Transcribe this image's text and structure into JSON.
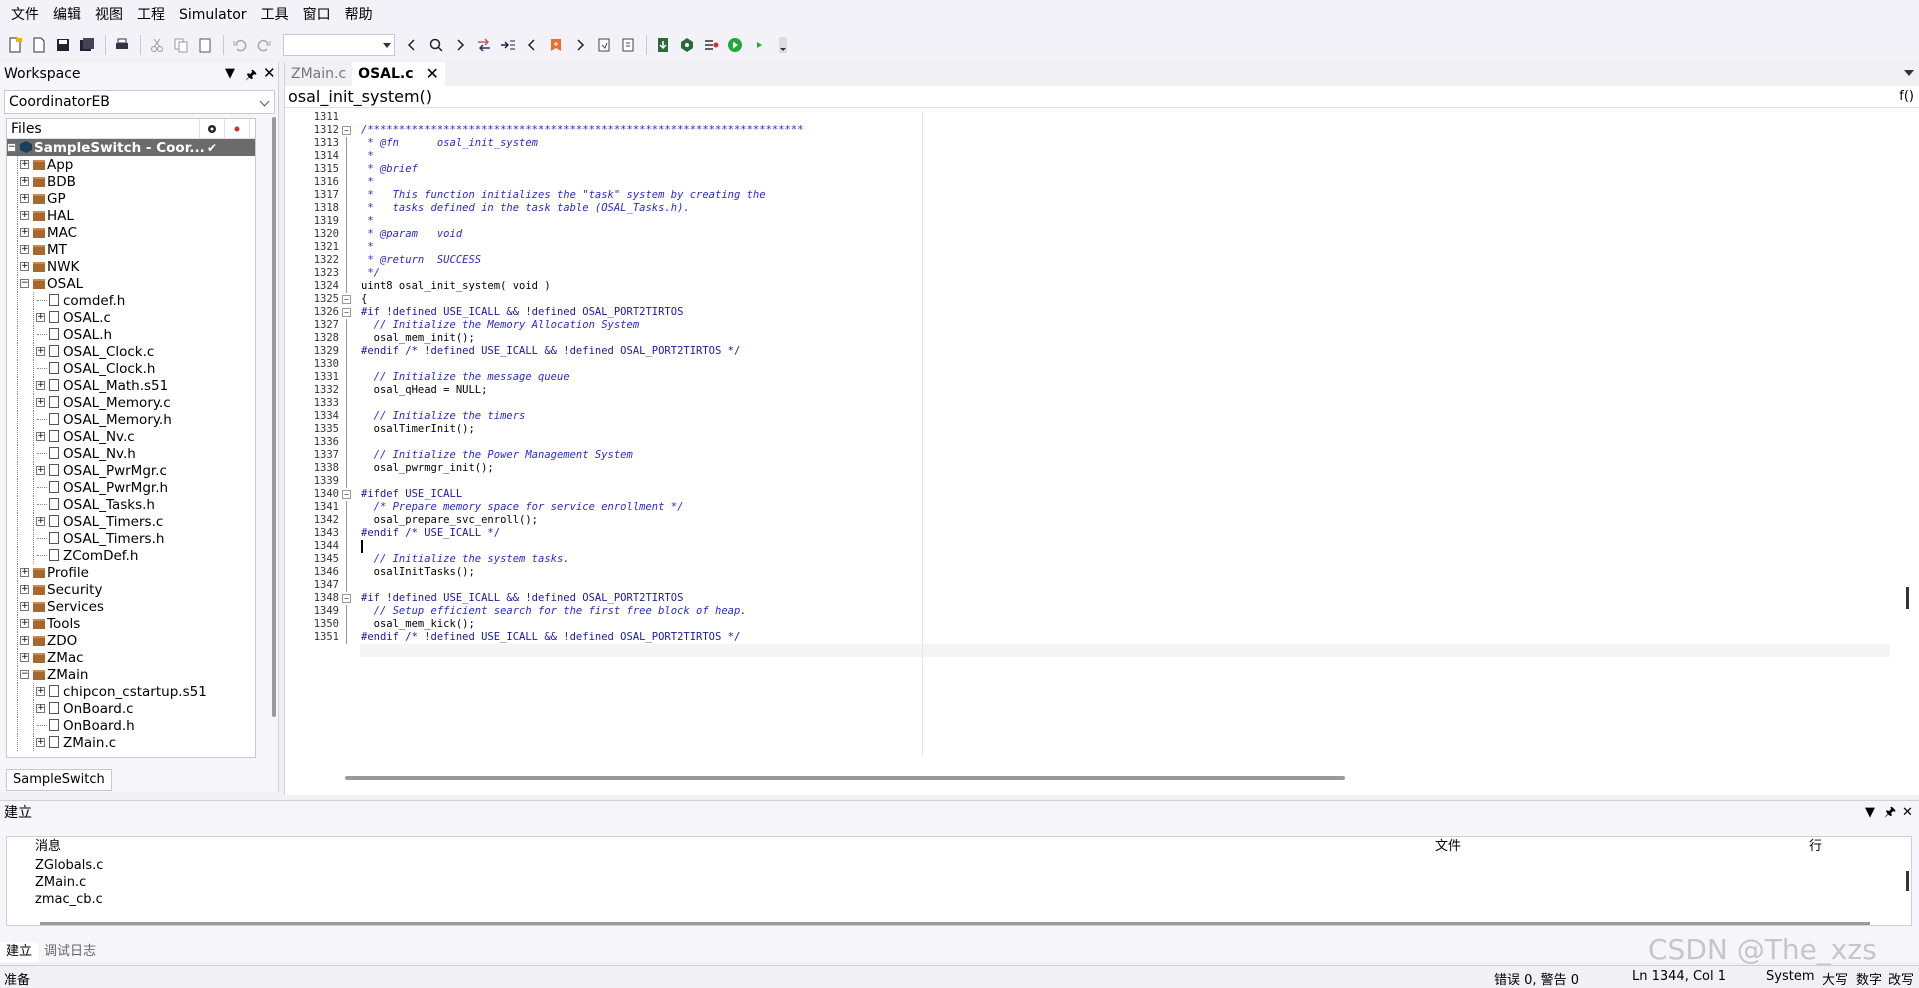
{
  "menu": [
    "文件",
    "编辑",
    "视图",
    "工程",
    "Simulator",
    "工具",
    "窗口",
    "帮助"
  ],
  "workspace": {
    "title": "Workspace",
    "config": "CoordinatorEB",
    "files_header": "Files",
    "tab": "SampleSwitch",
    "tree": [
      {
        "label": "SampleSwitch - Coor...",
        "type": "project",
        "level": 0,
        "exp": "-",
        "sel": true
      },
      {
        "label": "App",
        "type": "folder",
        "level": 1,
        "exp": "+"
      },
      {
        "label": "BDB",
        "type": "folder",
        "level": 1,
        "exp": "+"
      },
      {
        "label": "GP",
        "type": "folder",
        "level": 1,
        "exp": "+"
      },
      {
        "label": "HAL",
        "type": "folder",
        "level": 1,
        "exp": "+"
      },
      {
        "label": "MAC",
        "type": "folder",
        "level": 1,
        "exp": "+"
      },
      {
        "label": "MT",
        "type": "folder",
        "level": 1,
        "exp": "+"
      },
      {
        "label": "NWK",
        "type": "folder",
        "level": 1,
        "exp": "+"
      },
      {
        "label": "OSAL",
        "type": "folder",
        "level": 1,
        "exp": "-"
      },
      {
        "label": "comdef.h",
        "type": "file",
        "level": 2,
        "exp": ""
      },
      {
        "label": "OSAL.c",
        "type": "file",
        "level": 2,
        "exp": "+"
      },
      {
        "label": "OSAL.h",
        "type": "file",
        "level": 2,
        "exp": ""
      },
      {
        "label": "OSAL_Clock.c",
        "type": "file",
        "level": 2,
        "exp": "+"
      },
      {
        "label": "OSAL_Clock.h",
        "type": "file",
        "level": 2,
        "exp": ""
      },
      {
        "label": "OSAL_Math.s51",
        "type": "file",
        "level": 2,
        "exp": "+"
      },
      {
        "label": "OSAL_Memory.c",
        "type": "file",
        "level": 2,
        "exp": "+"
      },
      {
        "label": "OSAL_Memory.h",
        "type": "file",
        "level": 2,
        "exp": ""
      },
      {
        "label": "OSAL_Nv.c",
        "type": "file",
        "level": 2,
        "exp": "+"
      },
      {
        "label": "OSAL_Nv.h",
        "type": "file",
        "level": 2,
        "exp": ""
      },
      {
        "label": "OSAL_PwrMgr.c",
        "type": "file",
        "level": 2,
        "exp": "+"
      },
      {
        "label": "OSAL_PwrMgr.h",
        "type": "file",
        "level": 2,
        "exp": ""
      },
      {
        "label": "OSAL_Tasks.h",
        "type": "file",
        "level": 2,
        "exp": ""
      },
      {
        "label": "OSAL_Timers.c",
        "type": "file",
        "level": 2,
        "exp": "+"
      },
      {
        "label": "OSAL_Timers.h",
        "type": "file",
        "level": 2,
        "exp": ""
      },
      {
        "label": "ZComDef.h",
        "type": "file",
        "level": 2,
        "exp": ""
      },
      {
        "label": "Profile",
        "type": "folder",
        "level": 1,
        "exp": "+"
      },
      {
        "label": "Security",
        "type": "folder",
        "level": 1,
        "exp": "+"
      },
      {
        "label": "Services",
        "type": "folder",
        "level": 1,
        "exp": "+"
      },
      {
        "label": "Tools",
        "type": "folder",
        "level": 1,
        "exp": "+"
      },
      {
        "label": "ZDO",
        "type": "folder",
        "level": 1,
        "exp": "+"
      },
      {
        "label": "ZMac",
        "type": "folder",
        "level": 1,
        "exp": "+"
      },
      {
        "label": "ZMain",
        "type": "folder",
        "level": 1,
        "exp": "-"
      },
      {
        "label": "chipcon_cstartup.s51",
        "type": "file",
        "level": 2,
        "exp": "+"
      },
      {
        "label": "OnBoard.c",
        "type": "file",
        "level": 2,
        "exp": "+"
      },
      {
        "label": "OnBoard.h",
        "type": "file",
        "level": 2,
        "exp": ""
      },
      {
        "label": "ZMain.c",
        "type": "file",
        "level": 2,
        "exp": "+"
      }
    ]
  },
  "editor": {
    "tabs": [
      {
        "label": "ZMain.c",
        "active": false
      },
      {
        "label": "OSAL.c",
        "active": true
      }
    ],
    "function": "osal_init_system()",
    "func_icon": "f()",
    "lines": [
      {
        "n": "1311",
        "t": "",
        "c": "n"
      },
      {
        "n": "1312",
        "t": "/*********************************************************************",
        "c": "comment",
        "f": "-"
      },
      {
        "n": "1313",
        "t": " * @fn      osal_init_system",
        "c": "comment"
      },
      {
        "n": "1314",
        "t": " *",
        "c": "comment"
      },
      {
        "n": "1315",
        "t": " * @brief",
        "c": "comment"
      },
      {
        "n": "1316",
        "t": " *",
        "c": "comment"
      },
      {
        "n": "1317",
        "t": " *   This function initializes the \"task\" system by creating the",
        "c": "comment"
      },
      {
        "n": "1318",
        "t": " *   tasks defined in the task table (OSAL_Tasks.h).",
        "c": "comment"
      },
      {
        "n": "1319",
        "t": " *",
        "c": "comment"
      },
      {
        "n": "1320",
        "t": " * @param   void",
        "c": "comment"
      },
      {
        "n": "1321",
        "t": " *",
        "c": "comment"
      },
      {
        "n": "1322",
        "t": " * @return  SUCCESS",
        "c": "comment"
      },
      {
        "n": "1323",
        "t": " */",
        "c": "comment"
      },
      {
        "n": "1324",
        "t": "uint8 osal_init_system( void )",
        "c": "n"
      },
      {
        "n": "1325",
        "t": "{",
        "c": "n",
        "f": "-"
      },
      {
        "n": "1326",
        "t": "#if !defined USE_ICALL && !defined OSAL_PORT2TIRTOS",
        "c": "pp",
        "f": "-"
      },
      {
        "n": "1327",
        "t": "  // Initialize the Memory Allocation System",
        "c": "comment"
      },
      {
        "n": "1328",
        "t": "  osal_mem_init();",
        "c": "n"
      },
      {
        "n": "1329",
        "t": "#endif /* !defined USE_ICALL && !defined OSAL_PORT2TIRTOS */",
        "c": "pp"
      },
      {
        "n": "1330",
        "t": "",
        "c": "n"
      },
      {
        "n": "1331",
        "t": "  // Initialize the message queue",
        "c": "comment"
      },
      {
        "n": "1332",
        "t": "  osal_qHead = NULL;",
        "c": "n"
      },
      {
        "n": "1333",
        "t": "",
        "c": "n"
      },
      {
        "n": "1334",
        "t": "  // Initialize the timers",
        "c": "comment"
      },
      {
        "n": "1335",
        "t": "  osalTimerInit();",
        "c": "n"
      },
      {
        "n": "1336",
        "t": "",
        "c": "n"
      },
      {
        "n": "1337",
        "t": "  // Initialize the Power Management System",
        "c": "comment"
      },
      {
        "n": "1338",
        "t": "  osal_pwrmgr_init();",
        "c": "n"
      },
      {
        "n": "1339",
        "t": "",
        "c": "n"
      },
      {
        "n": "1340",
        "t": "#ifdef USE_ICALL",
        "c": "pp",
        "f": "-"
      },
      {
        "n": "1341",
        "t": "  /* Prepare memory space for service enrollment */",
        "c": "comment"
      },
      {
        "n": "1342",
        "t": "  osal_prepare_svc_enroll();",
        "c": "n"
      },
      {
        "n": "1343",
        "t": "#endif /* USE_ICALL */",
        "c": "pp"
      },
      {
        "n": "1344",
        "t": "",
        "c": "cur"
      },
      {
        "n": "1345",
        "t": "  // Initialize the system tasks.",
        "c": "comment"
      },
      {
        "n": "1346",
        "t": "  osalInitTasks();",
        "c": "n"
      },
      {
        "n": "1347",
        "t": "",
        "c": "n"
      },
      {
        "n": "1348",
        "t": "#if !defined USE_ICALL && !defined OSAL_PORT2TIRTOS",
        "c": "pp",
        "f": "-"
      },
      {
        "n": "1349",
        "t": "  // Setup efficient search for the first free block of heap.",
        "c": "comment"
      },
      {
        "n": "1350",
        "t": "  osal_mem_kick();",
        "c": "n"
      },
      {
        "n": "1351",
        "t": "#endif /* !defined USE_ICALL && !defined OSAL_PORT2TIRTOS */",
        "c": "pp"
      }
    ]
  },
  "build": {
    "title": "建立",
    "col_message": "消息",
    "col_file": "文件",
    "col_line": "行",
    "rows": [
      "ZGlobals.c",
      "ZMain.c",
      "zmac_cb.c"
    ],
    "tabs": [
      "建立",
      "调试日志"
    ]
  },
  "status": {
    "left": "准备",
    "errors": "错误 0, 警告 0",
    "pos": "Ln 1344, Col 1",
    "enc": "System",
    "caps": "大写",
    "num": "数字",
    "ovr": "改写"
  },
  "watermark": "CSDN @The_xzs"
}
